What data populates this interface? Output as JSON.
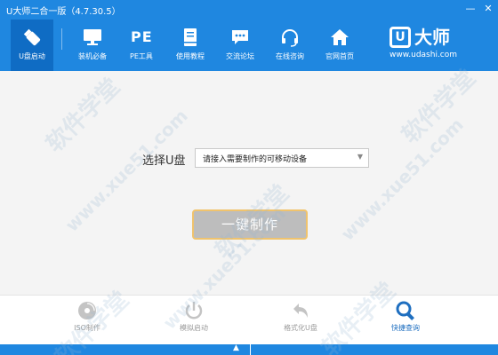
{
  "window": {
    "title": "U大师二合一版（4.7.30.5）",
    "minimize_glyph": "—",
    "close_glyph": "✕"
  },
  "nav": {
    "items": [
      {
        "label": "U盘启动",
        "icon": "usb-drive-icon",
        "active": true
      },
      {
        "label": "装机必备",
        "icon": "monitor-icon"
      },
      {
        "label": "PE工具",
        "icon": "pe-icon",
        "icon_text": "PE"
      },
      {
        "label": "使用教程",
        "icon": "book-icon"
      },
      {
        "label": "交流论坛",
        "icon": "chat-bubble-icon"
      },
      {
        "label": "在线咨询",
        "icon": "headset-icon"
      },
      {
        "label": "官网首页",
        "icon": "home-icon"
      }
    ]
  },
  "brand": {
    "mark": "U",
    "name": "大师",
    "url": "www.udashi.com"
  },
  "main": {
    "select_label": "选择U盘",
    "select_value": "请接入需要制作的可移动设备",
    "select_arrow": "▼",
    "make_button": "一键制作"
  },
  "tools": [
    {
      "label": "ISO制作",
      "icon": "disc-icon"
    },
    {
      "label": "模拟启动",
      "icon": "power-icon"
    },
    {
      "label": "格式化U盘",
      "icon": "undo-arrow-icon"
    },
    {
      "label": "快捷查询",
      "icon": "magnifier-icon",
      "active": true
    }
  ],
  "status": {
    "arrow": "▲"
  },
  "watermarks": [
    "软件学堂",
    "www.xue51.com",
    "软件学堂",
    "www.xue51.com",
    "软件学堂",
    "软件学堂",
    "www.xue51.com",
    "软件学堂"
  ],
  "colors": {
    "header": "#1f87e0",
    "active_tab": "#0f6cc4",
    "button_disabled": "#bdbdbd",
    "button_border": "#f0c36d",
    "active_tool": "#1f6fc0"
  }
}
